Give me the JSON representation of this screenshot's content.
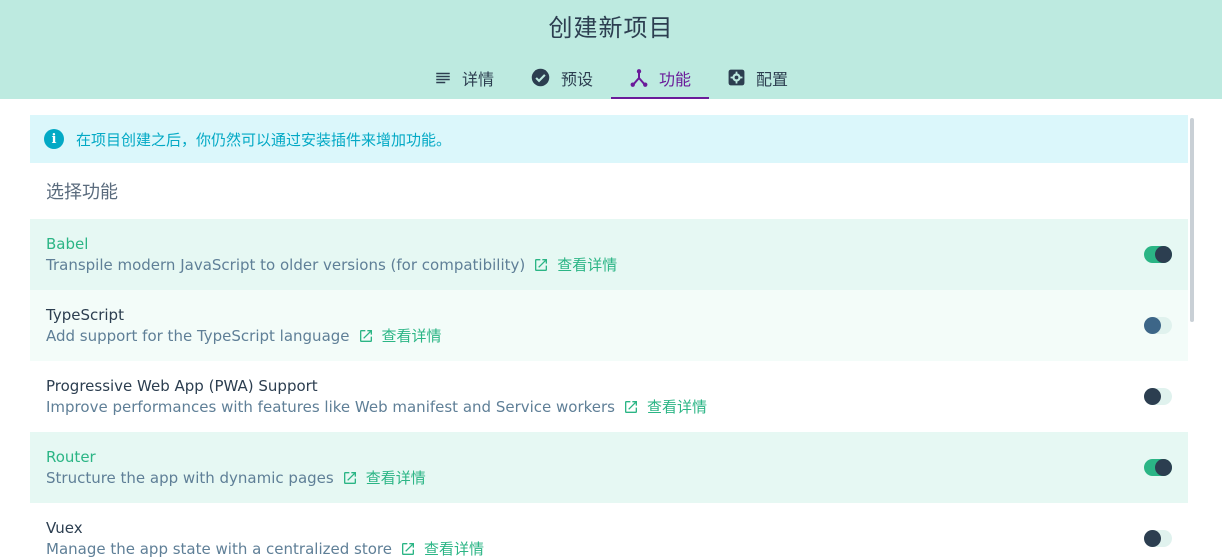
{
  "header": {
    "title": "创建新项目",
    "tabs": [
      {
        "label": "详情",
        "icon": "list-icon",
        "active": false
      },
      {
        "label": "预设",
        "icon": "check-circle-icon",
        "active": false
      },
      {
        "label": "功能",
        "icon": "call-split-icon",
        "active": true
      },
      {
        "label": "配置",
        "icon": "settings-box-icon",
        "active": false
      }
    ]
  },
  "info": {
    "text": "在项目创建之后，你仍然可以通过安装插件来增加功能。",
    "icon": "info-icon"
  },
  "section_title": "选择功能",
  "link_label": "查看详情",
  "features": [
    {
      "name": "Babel",
      "description": "Transpile modern JavaScript to older versions (for compatibility)",
      "enabled": true
    },
    {
      "name": "TypeScript",
      "description": "Add support for the TypeScript language",
      "enabled": false
    },
    {
      "name": "Progressive Web App (PWA) Support",
      "description": "Improve performances with features like Web manifest and Service workers",
      "enabled": false
    },
    {
      "name": "Router",
      "description": "Structure the app with dynamic pages",
      "enabled": true
    },
    {
      "name": "Vuex",
      "description": "Manage the app state with a centralized store",
      "enabled": false
    }
  ],
  "colors": {
    "header_bg": "#bdeae0",
    "accent_green": "#2bb585",
    "active_tab": "#6a1b9a",
    "info_text": "#03a9c5",
    "info_bg": "#dbf7fb",
    "text_dark": "#2c3e50"
  }
}
